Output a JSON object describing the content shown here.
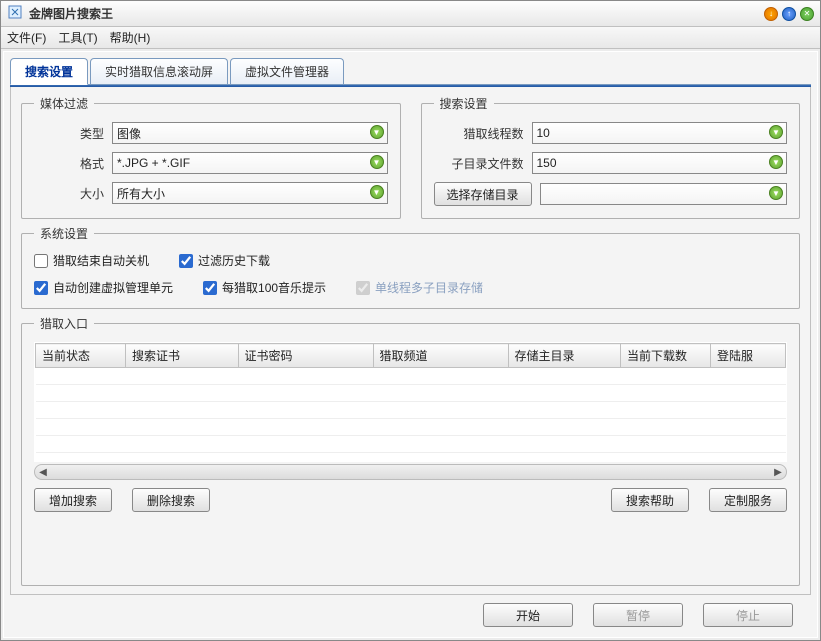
{
  "window": {
    "title": "金牌图片搜索王"
  },
  "menu": {
    "file": "文件(F)",
    "tools": "工具(T)",
    "help": "帮助(H)"
  },
  "tabs": {
    "t1": "搜索设置",
    "t2": "实时猎取信息滚动屏",
    "t3": "虚拟文件管理器"
  },
  "mediaFilter": {
    "legend": "媒体过滤",
    "typeLabel": "类型",
    "typeValue": "图像",
    "formatLabel": "格式",
    "formatValue": "*.JPG + *.GIF",
    "sizeLabel": "大小",
    "sizeValue": "所有大小"
  },
  "searchSettings": {
    "legend": "搜索设置",
    "threadsLabel": "猎取线程数",
    "threadsValue": "10",
    "subdirLabel": "子目录文件数",
    "subdirValue": "150",
    "chooseDirBtn": "选择存储目录",
    "dirValue": ""
  },
  "systemSettings": {
    "legend": "系统设置",
    "c1": "猎取结束自动关机",
    "c2": "过滤历史下载",
    "c3": "自动创建虚拟管理单元",
    "c4": "每猎取100音乐提示",
    "c5": "单线程多子目录存储"
  },
  "entryList": {
    "legend": "猎取入口",
    "headers": {
      "h1": "当前状态",
      "h2": "搜索证书",
      "h3": "证书密码",
      "h4": "猎取频道",
      "h5": "存储主目录",
      "h6": "当前下载数",
      "h7": "登陆服"
    }
  },
  "buttons": {
    "addSearch": "增加搜索",
    "delSearch": "删除搜索",
    "searchHelp": "搜索帮助",
    "customService": "定制服务",
    "start": "开始",
    "pause": "暂停",
    "stop": "停止"
  }
}
